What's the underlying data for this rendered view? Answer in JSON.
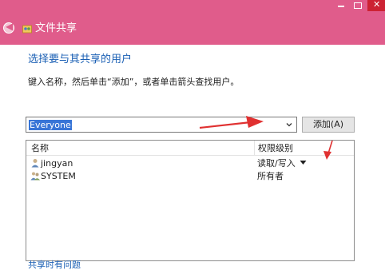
{
  "window": {
    "title": "文件共享",
    "controls": {
      "minimize": "—",
      "maximize": "□",
      "close": "✕"
    },
    "accent_color": "#e05c8b"
  },
  "main": {
    "heading": "选择要与其共享的用户",
    "instruction": "键入名称，然后单击“添加”，或者单击箭头查找用户。",
    "combo": {
      "value": "Everyone"
    },
    "add_button_label": "添加(A)",
    "table": {
      "columns": [
        "名称",
        "权限级别"
      ],
      "rows": [
        {
          "name": "jingyan",
          "permission": "读取/写入",
          "icon": "user-icon",
          "has_dropdown": true
        },
        {
          "name": "SYSTEM",
          "permission": "所有者",
          "icon": "group-icon",
          "has_dropdown": false
        }
      ]
    },
    "footer_link": "共享时有问题"
  },
  "annotations": {
    "arrow_color": "#e03131"
  }
}
